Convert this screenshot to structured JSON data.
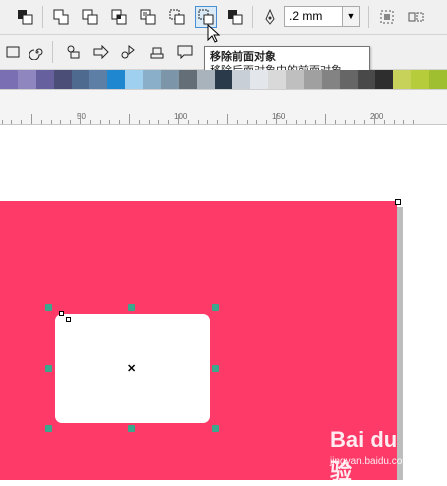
{
  "toolbar1": {
    "outline_width_value": ".2 mm",
    "dropdown_arrow": "▼",
    "buttons": [
      {
        "name": "arrange-front-icon"
      },
      {
        "name": "weld-icon"
      },
      {
        "name": "trim-icon"
      },
      {
        "name": "intersect-icon"
      },
      {
        "name": "simplify-icon"
      },
      {
        "name": "front-minus-back-icon"
      },
      {
        "name": "back-minus-front-icon"
      },
      {
        "name": "create-boundary-icon"
      },
      {
        "name": "pen-outline-icon"
      }
    ]
  },
  "tooltip": {
    "title": "移除前面对象",
    "description": "移除后面对象中的前面对象。"
  },
  "ruler": {
    "labels": [
      "50",
      "100",
      "150",
      "200"
    ]
  },
  "palette": {
    "colors": [
      "#7b6fb4",
      "#8f86c0",
      "#66609e",
      "#4b4f78",
      "#4e6a8e",
      "#5d7fa6",
      "#1e87cf",
      "#9fd0ef",
      "#8ab0c9",
      "#7d95a8",
      "#646e77",
      "#a8b3bc",
      "#2b3a4a",
      "#c9cfd6",
      "#e3e6ea",
      "#d9d9d9",
      "#bfbfbf",
      "#a0a0a0",
      "#838383",
      "#666666",
      "#494949",
      "#2e2e2e",
      "#c6d25a",
      "#b6cc3a",
      "#9fbf30"
    ]
  },
  "watermark": {
    "brand": "Bai du 经验",
    "url": "jingyan.baidu.com"
  }
}
